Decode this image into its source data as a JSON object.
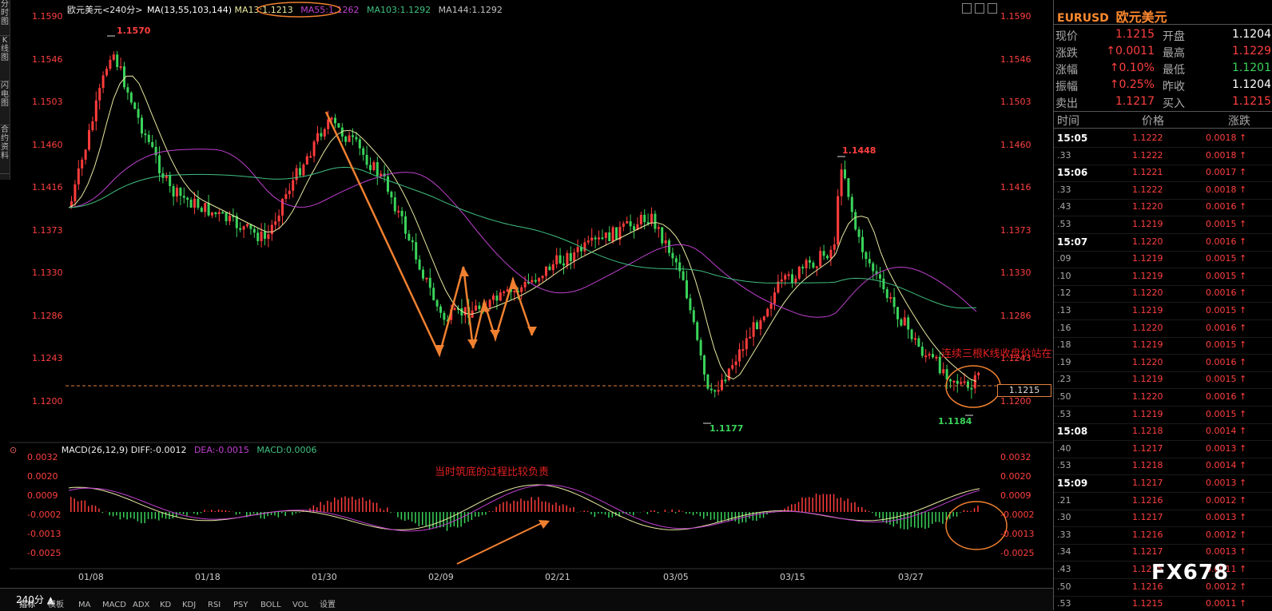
{
  "left_tabs": [
    "分时图",
    "K线图",
    "闪电图",
    "合约资料"
  ],
  "header": {
    "symbol": "欧元美元",
    "period": "<240分>",
    "ma_label": "MA(13,55,103,144)",
    "ma13": "MA13:1.1213",
    "ma55": "MA55:1.1262",
    "ma103": "MA103:1.1292",
    "ma144": "MA144:1.1292",
    "icons": [
      "list-icon",
      "grid-icon",
      "bars-icon"
    ]
  },
  "price_axis": [
    "1.1590",
    "1.1546",
    "1.1503",
    "1.1460",
    "1.1416",
    "1.1373",
    "1.1330",
    "1.1286",
    "1.1243",
    "1.1200"
  ],
  "price_labels": {
    "high": "1.1570",
    "mid_high": "1.1448",
    "low": "1.1177",
    "low2": "1.1184",
    "current": "1.1215"
  },
  "annotations": {
    "upper_note": "连续三根K线收盘价站在黄线之上可看多",
    "lower_note": "当时筑底的过程比较负责",
    "watermark": "FX678"
  },
  "macd": {
    "label": "MACD(26,12,9)",
    "diff": "DIFF:-0.0012",
    "dea": "DEA:-0.0015",
    "macd": "MACD:0.0006",
    "axis": [
      "0.0032",
      "0.0020",
      "0.0009",
      "-0.0002",
      "-0.0013",
      "-0.0025"
    ]
  },
  "dates": [
    "01/08",
    "01/18",
    "01/30",
    "02/09",
    "02/21",
    "03/05",
    "03/15",
    "03/27"
  ],
  "bottom_tabs": [
    "240分 ▲",
    "指标",
    "模板",
    "MA",
    "MACD",
    "ADX",
    "KD",
    "KDJ",
    "RSI",
    "PSY",
    "BOLL",
    "VOL",
    "设置"
  ],
  "quote": {
    "code": "EURUSD",
    "name": "欧元美元",
    "rows": [
      {
        "l1": "现价",
        "v1": "1.1215",
        "l2": "开盘",
        "v2": "1.1204"
      },
      {
        "l1": "涨跌",
        "v1": "↑0.0011",
        "l2": "最高",
        "v2": "1.1229"
      },
      {
        "l1": "涨幅",
        "v1": "↑0.10%",
        "l2": "最低",
        "v2": "1.1201"
      },
      {
        "l1": "振幅",
        "v1": "↑0.25%",
        "l2": "昨收",
        "v2": "1.1204"
      },
      {
        "l1": "卖出",
        "v1": "1.1217",
        "l2": "买入",
        "v2": "1.1215"
      }
    ]
  },
  "ticks": {
    "headers": [
      "时间",
      "价格",
      "涨跌"
    ],
    "rows": [
      {
        "t": "15:05",
        "p": "1.1222",
        "c": "0.0018"
      },
      {
        "t": ".33",
        "p": "1.1222",
        "c": "0.0018"
      },
      {
        "t": "15:06",
        "p": "1.1221",
        "c": "0.0017"
      },
      {
        "t": ".33",
        "p": "1.1222",
        "c": "0.0018"
      },
      {
        "t": ".43",
        "p": "1.1220",
        "c": "0.0016"
      },
      {
        "t": ".53",
        "p": "1.1219",
        "c": "0.0015"
      },
      {
        "t": "15:07",
        "p": "1.1220",
        "c": "0.0016"
      },
      {
        "t": ".09",
        "p": "1.1219",
        "c": "0.0015"
      },
      {
        "t": ".10",
        "p": "1.1219",
        "c": "0.0015"
      },
      {
        "t": ".12",
        "p": "1.1220",
        "c": "0.0016"
      },
      {
        "t": ".13",
        "p": "1.1219",
        "c": "0.0015"
      },
      {
        "t": ".16",
        "p": "1.1220",
        "c": "0.0016"
      },
      {
        "t": ".18",
        "p": "1.1219",
        "c": "0.0015"
      },
      {
        "t": ".19",
        "p": "1.1220",
        "c": "0.0016"
      },
      {
        "t": ".23",
        "p": "1.1219",
        "c": "0.0015"
      },
      {
        "t": ".50",
        "p": "1.1220",
        "c": "0.0016"
      },
      {
        "t": ".53",
        "p": "1.1219",
        "c": "0.0015"
      },
      {
        "t": "15:08",
        "p": "1.1218",
        "c": "0.0014"
      },
      {
        "t": ".40",
        "p": "1.1217",
        "c": "0.0013"
      },
      {
        "t": ".53",
        "p": "1.1218",
        "c": "0.0014"
      },
      {
        "t": "15:09",
        "p": "1.1217",
        "c": "0.0013"
      },
      {
        "t": ".21",
        "p": "1.1216",
        "c": "0.0012"
      },
      {
        "t": ".30",
        "p": "1.1217",
        "c": "0.0013"
      },
      {
        "t": ".33",
        "p": "1.1216",
        "c": "0.0012"
      },
      {
        "t": ".34",
        "p": "1.1217",
        "c": "0.0013"
      },
      {
        "t": ".43",
        "p": "1.1215",
        "c": "0.0011"
      },
      {
        "t": ".50",
        "p": "1.1216",
        "c": "0.0012"
      },
      {
        "t": ".53",
        "p": "1.1215",
        "c": "0.0011"
      }
    ]
  },
  "colors": {
    "up": "#ff3c3c",
    "down": "#3ad35a",
    "ma13": "#e8e8a0",
    "ma55": "#c040d0",
    "ma103": "#40c080",
    "ma144": "#c0c0c0",
    "annotation": "#f08030"
  }
}
